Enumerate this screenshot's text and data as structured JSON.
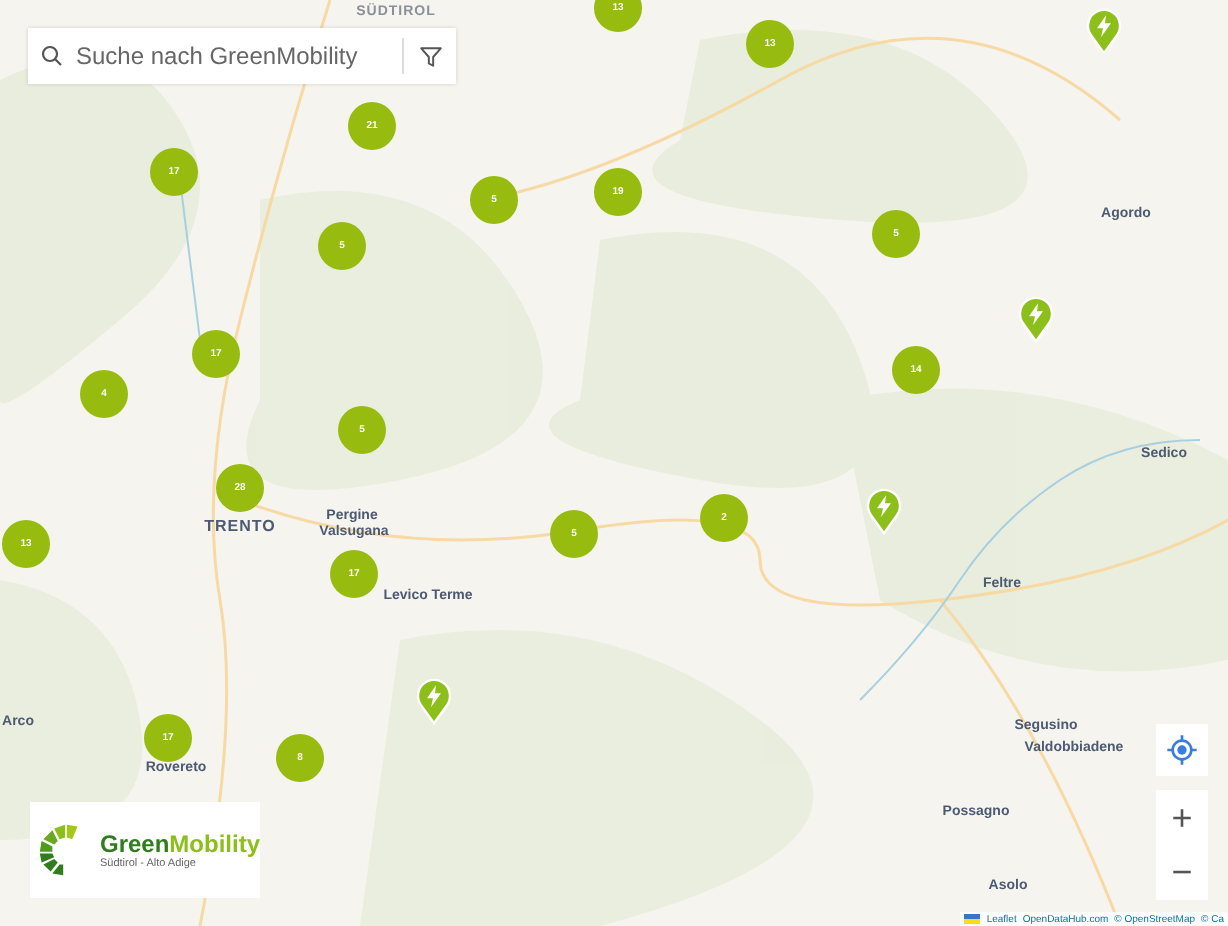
{
  "search": {
    "placeholder": "Suche nach GreenMobility"
  },
  "place_labels": [
    {
      "text": "SÜDTIROL",
      "kind": "region"
    },
    {
      "text": "Agordo",
      "kind": "town"
    },
    {
      "text": "Sedico",
      "kind": "town"
    },
    {
      "text": "TRENTO",
      "kind": "city"
    },
    {
      "text": "Pergine",
      "kind": "town"
    },
    {
      "text": "Valsugana",
      "kind": "town"
    },
    {
      "text": "Levico Terme",
      "kind": "town"
    },
    {
      "text": "Feltre",
      "kind": "town"
    },
    {
      "text": "Segusino",
      "kind": "town"
    },
    {
      "text": "Valdobbiadene",
      "kind": "town"
    },
    {
      "text": "Possagno",
      "kind": "town"
    },
    {
      "text": "Asolo",
      "kind": "town"
    },
    {
      "text": "Arco",
      "kind": "town"
    },
    {
      "text": "Rovereto",
      "kind": "town"
    }
  ],
  "markers": [
    {
      "kind": "cluster",
      "count": "13"
    },
    {
      "kind": "cluster",
      "count": "13"
    },
    {
      "kind": "cluster",
      "count": "21"
    },
    {
      "kind": "cluster",
      "count": "17"
    },
    {
      "kind": "cluster",
      "count": "5"
    },
    {
      "kind": "cluster",
      "count": "19"
    },
    {
      "kind": "cluster",
      "count": "5"
    },
    {
      "kind": "cluster",
      "count": "5"
    },
    {
      "kind": "cluster",
      "count": "17"
    },
    {
      "kind": "cluster",
      "count": "14"
    },
    {
      "kind": "cluster",
      "count": "4"
    },
    {
      "kind": "cluster",
      "count": "5"
    },
    {
      "kind": "cluster",
      "count": "28"
    },
    {
      "kind": "cluster",
      "count": "13"
    },
    {
      "kind": "cluster",
      "count": "2"
    },
    {
      "kind": "cluster",
      "count": "5"
    },
    {
      "kind": "cluster",
      "count": "17"
    },
    {
      "kind": "cluster",
      "count": "17"
    },
    {
      "kind": "cluster",
      "count": "8"
    },
    {
      "kind": "charger"
    },
    {
      "kind": "charger"
    },
    {
      "kind": "charger"
    },
    {
      "kind": "charger"
    }
  ],
  "logo": {
    "name_part1": "Green",
    "name_part2": "Mobility",
    "subtitle": "Südtirol - Alto Adige"
  },
  "zoom_controls": {
    "zoom_in": "+",
    "zoom_out": "−"
  },
  "attribution": {
    "links": [
      "Leaflet",
      "OpenDataHub.com",
      "© OpenStreetMap",
      "© Ca"
    ]
  }
}
